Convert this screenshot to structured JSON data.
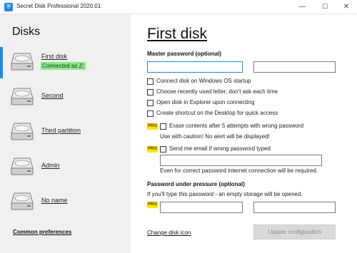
{
  "window": {
    "title": "Secret Disk Professional 2020.01",
    "minimize_glyph": "—",
    "maximize_glyph": "☐",
    "close_glyph": "✕"
  },
  "sidebar": {
    "title": "Disks",
    "items": [
      {
        "label": "First disk",
        "status": "Connected as Z:",
        "icon": "hard-drive-icon"
      },
      {
        "label": "Second",
        "icon": "hard-drive-icon"
      },
      {
        "label": "Third partition",
        "icon": "hard-drive-icon"
      },
      {
        "label": "Admin",
        "icon": "hard-drive-icon"
      },
      {
        "label": "No name",
        "icon": "hard-drive-icon"
      }
    ],
    "common_preferences": "Common preferences"
  },
  "main": {
    "title": "First disk",
    "master_password_label": "Master password (optional)",
    "options": [
      "Connect disk on Windows OS startup",
      "Choose recently used letter, don't ask each time",
      "Open disk in Explorer upon connecting",
      "Create shortcut on the Desktop for quick access"
    ],
    "pro_label": "PRO",
    "erase_option": "Erase contents after 5 attempts with wrong password",
    "erase_note": "Use with caution! No alert will be displayed!",
    "email_option": "Send me email if wrong password typed",
    "email_note": "Even for correct password internet connection will be required.",
    "pressure_label": "Password under pressure (optional)",
    "pressure_note": "If you'll type this password - an empty storage will be opened.",
    "change_icon_link": "Change disk icon",
    "update_button": "Update configuration"
  },
  "colors": {
    "accent": "#1e88e5",
    "connected_bg": "#8fe58f",
    "pro_badge": "#ffe600",
    "sidebar_bg": "#f0f0f0"
  }
}
